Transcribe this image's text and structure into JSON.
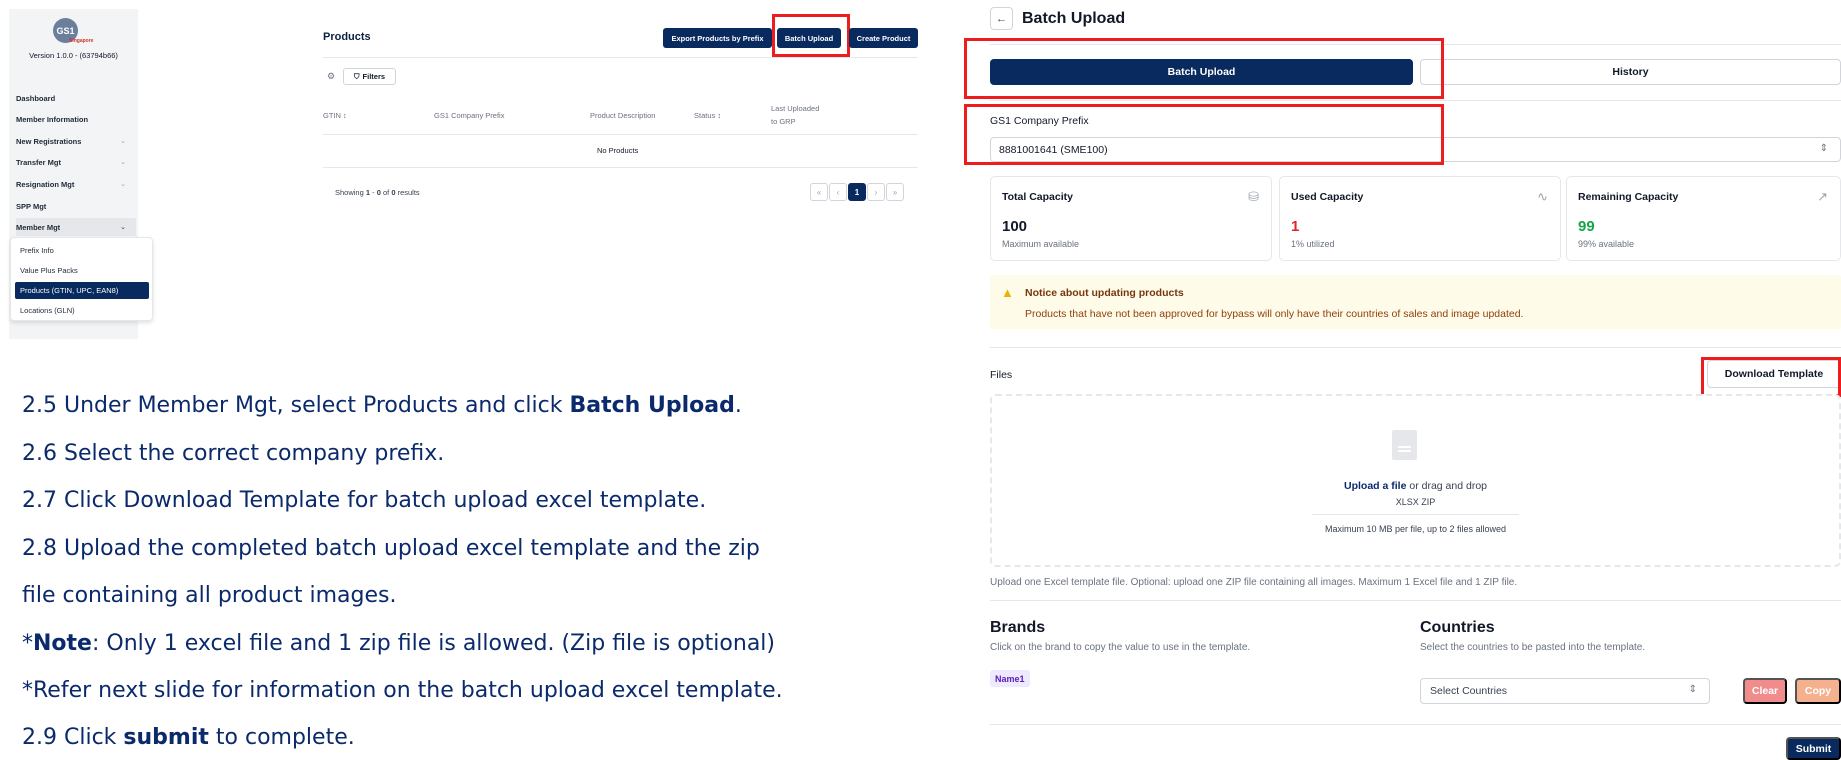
{
  "sidebar": {
    "logo_text": "GS1",
    "logo_sub": "Singapore",
    "version": "Version 1.0.0 - (63794b66)",
    "items": [
      {
        "label": "Dashboard",
        "chevron": ""
      },
      {
        "label": "Member Information",
        "chevron": ""
      },
      {
        "label": "New Registrations",
        "chevron": "⌄"
      },
      {
        "label": "Transfer Mgt",
        "chevron": "⌄"
      },
      {
        "label": "Resignation Mgt",
        "chevron": "⌄"
      },
      {
        "label": "SPP Mgt",
        "chevron": ""
      },
      {
        "label": "Member Mgt",
        "chevron": "⌄"
      }
    ],
    "submenu": [
      {
        "label": "Prefix Info"
      },
      {
        "label": "Value Plus Packs"
      },
      {
        "label": "Products (GTIN, UPC, EAN8)"
      },
      {
        "label": "Locations (GLN)"
      }
    ]
  },
  "products": {
    "title": "Products",
    "export_label": "Export Products by Prefix",
    "batch_label": "Batch Upload",
    "create_label": "Create Product",
    "filters_label": "Filters",
    "columns": {
      "gtin": "GTIN ↕",
      "prefix": "GS1 Company Prefix",
      "desc": "Product Description",
      "status": "Status ↕",
      "last1": "Last Uploaded",
      "last2": "to GRP"
    },
    "empty": "No Products",
    "showing_pre": "Showing ",
    "showing_a": "1",
    "showing_mid": " - ",
    "showing_b": "0",
    "showing_of": " of ",
    "showing_c": "0",
    "showing_post": " results",
    "pagination": {
      "first": "«",
      "prev": "‹",
      "current": "1",
      "next": "›",
      "last": "»"
    }
  },
  "instructions": {
    "s25_pre": "2.5 Under Member Mgt, select Products and click ",
    "s25_bold": "Batch Upload",
    "s25_post": ".",
    "s26": "2.6 Select the correct company prefix.",
    "s27": "2.7 Click Download Template for batch upload excel template.",
    "s28a": "2.8 Upload the completed batch upload excel template and the zip",
    "s28b": "file containing all product images.",
    "note_pre": "*",
    "note_bold": "Note",
    "note_post": ": Only 1 excel file and 1 zip file is allowed. (Zip file is optional)",
    "refer": "*Refer next slide for information on the batch upload excel template.",
    "s29_pre": "2.9 Click ",
    "s29_bold": "submit",
    "s29_post": " to complete."
  },
  "batch": {
    "back_icon": "←",
    "title": "Batch Upload",
    "tab_upload": "Batch Upload",
    "tab_history": "History",
    "prefix_label": "GS1 Company Prefix",
    "prefix_value": "8881001641 (SME100)",
    "cards": {
      "total": {
        "title": "Total Capacity",
        "value": "100",
        "sub": "Maximum available",
        "icon": "⛁"
      },
      "used": {
        "title": "Used Capacity",
        "value": "1",
        "sub": "1% utilized",
        "icon": "∿",
        "color": "#dc2626"
      },
      "remaining": {
        "title": "Remaining Capacity",
        "value": "99",
        "sub": "99% available",
        "icon": "↗",
        "color": "#16a34a"
      }
    },
    "notice_title": "Notice about updating products",
    "notice_text": "Products that have not been approved for bypass will only have their countries of sales and image updated.",
    "files_label": "Files",
    "download_template": "Download Template",
    "upload_link": "Upload a file",
    "upload_rest": " or drag and drop",
    "upload_types": "XLSX ZIP",
    "upload_max": "Maximum 10 MB per file, up to 2 files allowed",
    "upload_note": "Upload one Excel template file. Optional: upload one ZIP file containing all images. Maximum 1 Excel file and 1 ZIP file.",
    "brands_title": "Brands",
    "brands_sub": "Click on the brand to copy the value to use in the template.",
    "brand_chip": "Name1",
    "countries_title": "Countries",
    "countries_sub": "Select the countries to be pasted into the template.",
    "countries_placeholder": "Select Countries",
    "clear_label": "Clear",
    "copy_label": "Copy",
    "submit_label": "Submit"
  }
}
